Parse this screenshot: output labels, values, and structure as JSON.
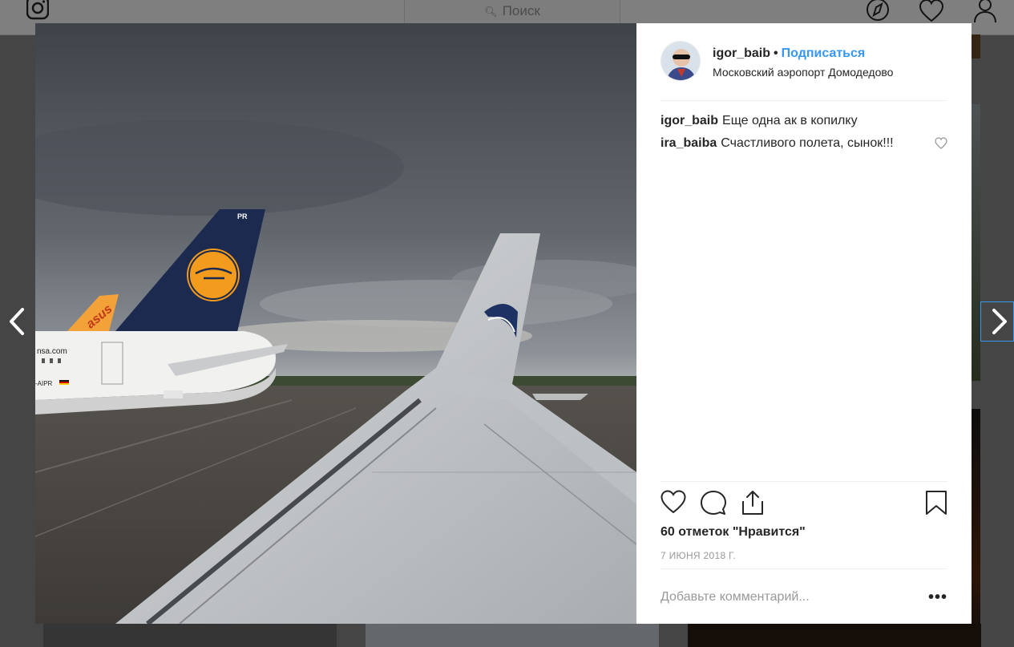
{
  "search": {
    "placeholder": "Поиск"
  },
  "post": {
    "username": "igor_baib",
    "separator": "•",
    "follow_label": "Подписаться",
    "location": "Московский аэропорт Домодедово",
    "comments": [
      {
        "user": "igor_baib",
        "text": "Еще одна ак в копилку",
        "likeable": false
      },
      {
        "user": "ira_baiba",
        "text": "Счастливого полета, сынок!!!",
        "likeable": true
      }
    ],
    "likes_text": "60 отметок \"Нравится\"",
    "date": "7 ИЮНЯ 2018 Г.",
    "comment_placeholder": "Добавьте комментарий...",
    "more_label": "•••"
  },
  "photo": {
    "tail_left_text": "PR",
    "fuselage_text": "nsa.com",
    "registration": "-AIPR",
    "orange_tail_text": "asus"
  },
  "colors": {
    "accent": "#3897f0",
    "text": "#262626",
    "muted": "#999999",
    "border": "#efefef"
  },
  "icons": [
    "instagram-logo-icon",
    "search-icon",
    "compass-icon",
    "heart-icon",
    "user-icon",
    "chevron-left-icon",
    "chevron-right-icon",
    "comment-icon",
    "share-icon",
    "bookmark-icon"
  ]
}
